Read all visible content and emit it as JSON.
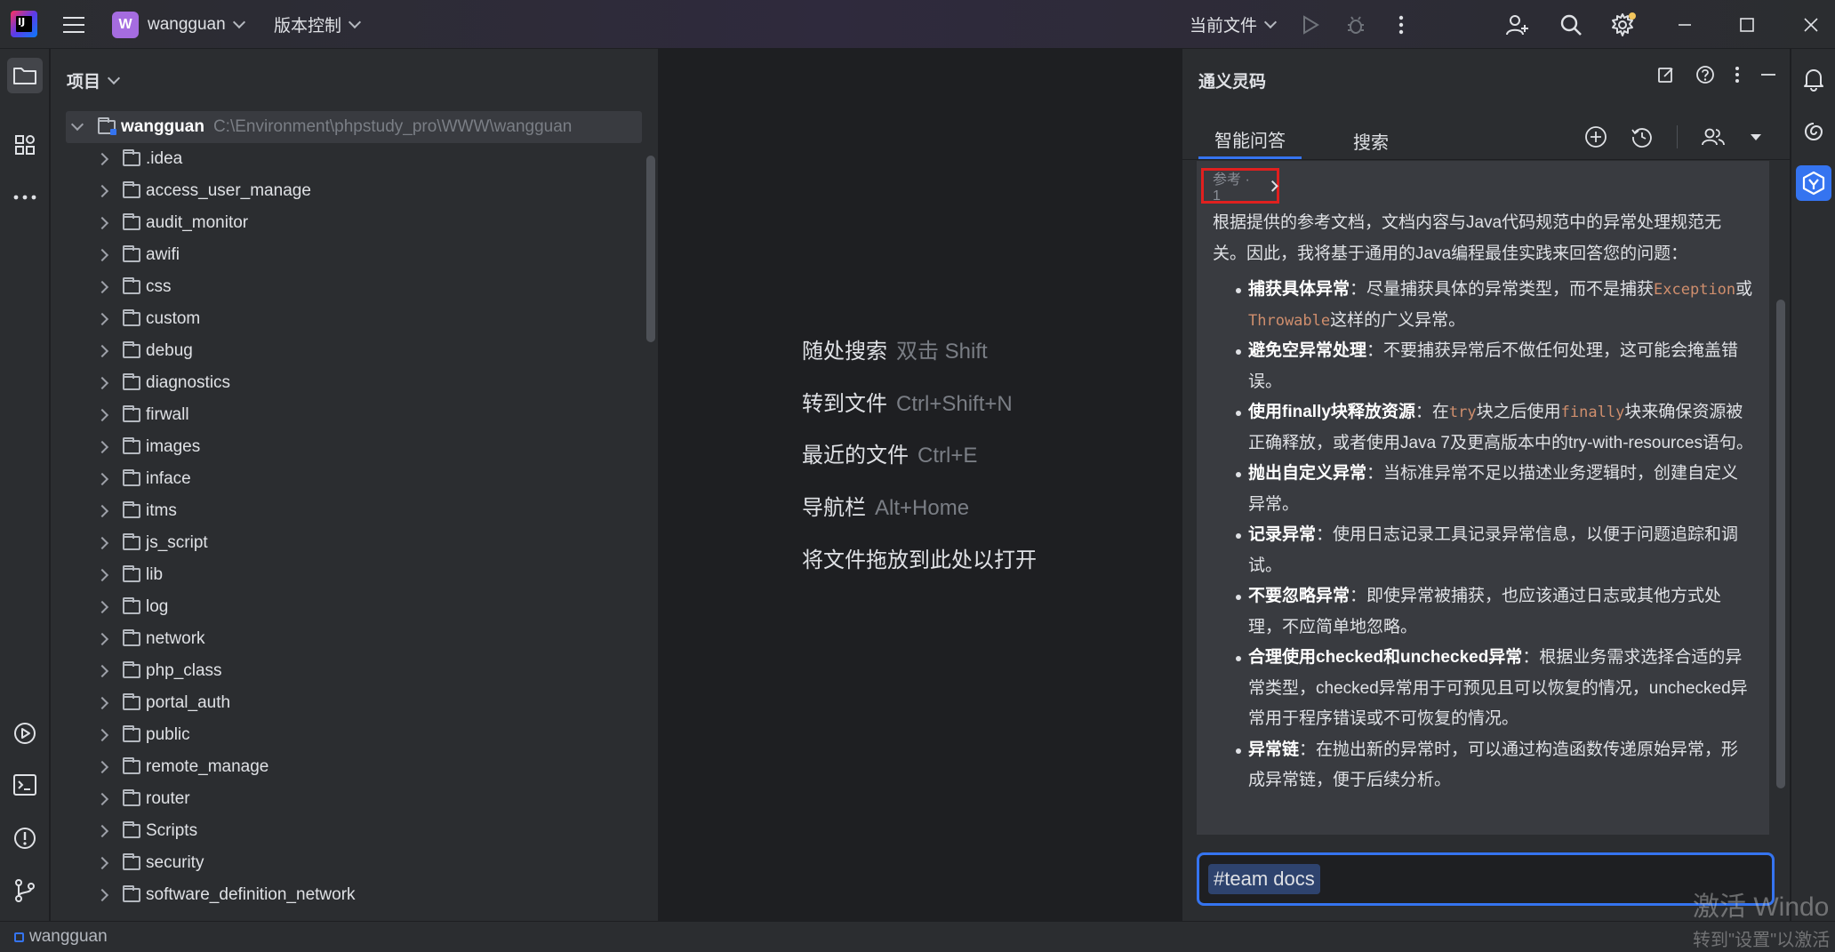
{
  "titlebar": {
    "project_badge": "W",
    "project_name": "wangguan",
    "vcs_menu": "版本控制",
    "run_config": "当前文件"
  },
  "project_panel": {
    "title": "项目",
    "root_name": "wangguan",
    "root_path": "C:\\Environment\\phpstudy_pro\\WWW\\wangguan",
    "folders": [
      ".idea",
      "access_user_manage",
      "audit_monitor",
      "awifi",
      "css",
      "custom",
      "debug",
      "diagnostics",
      "firwall",
      "images",
      "inface",
      "itms",
      "js_script",
      "lib",
      "log",
      "network",
      "php_class",
      "portal_auth",
      "public",
      "remote_manage",
      "router",
      "Scripts",
      "security",
      "software_definition_network"
    ]
  },
  "editor": {
    "hints": [
      {
        "label": "随处搜索",
        "shortcut": "双击 Shift"
      },
      {
        "label": "转到文件",
        "shortcut": "Ctrl+Shift+N"
      },
      {
        "label": "最近的文件",
        "shortcut": "Ctrl+E"
      },
      {
        "label": "导航栏",
        "shortcut": "Alt+Home"
      },
      {
        "label": "将文件拖放到此处以打开",
        "shortcut": ""
      }
    ]
  },
  "ai_panel": {
    "title": "通义灵码",
    "tabs": [
      "智能问答",
      "搜索"
    ],
    "reference": "参考 · 1",
    "intro": "根据提供的参考文档，文档内容与Java代码规范中的异常处理规范无关。因此，我将基于通用的Java编程最佳实践来回答您的问题：",
    "items": [
      {
        "title": "捕获具体异常",
        "text": "：尽量捕获具体的异常类型，而不是捕获",
        "code1": "Exception",
        "mid": "或",
        "code2": "Throwable",
        "tail": "这样的广义异常。"
      },
      {
        "title": "避免空异常处理",
        "text": "：不要捕获异常后不做任何处理，这可能会掩盖错误。"
      },
      {
        "title": "使用finally块释放资源",
        "text": "：在",
        "code1": "try",
        "mid": "块之后使用",
        "code2": "finally",
        "tail": "块来确保资源被正确释放，或者使用Java 7及更高版本中的try-with-resources语句。"
      },
      {
        "title": "抛出自定义异常",
        "text": "：当标准异常不足以描述业务逻辑时，创建自定义异常。"
      },
      {
        "title": "记录异常",
        "text": "：使用日志记录工具记录异常信息，以便于问题追踪和调试。"
      },
      {
        "title": "不要忽略异常",
        "text": "：即使异常被捕获，也应该通过日志或其他方式处理，不应简单地忽略。"
      },
      {
        "title": "合理使用checked和unchecked异常",
        "text": "：根据业务需求选择合适的异常类型，checked异常用于可预见且可以恢复的情况，unchecked异常用于程序错误或不可恢复的情况。"
      },
      {
        "title": "异常链",
        "text": "：在抛出新的异常时，可以通过构造函数传递原始异常，形成异常链，便于后续分析。"
      }
    ],
    "input_tag": "#team docs"
  },
  "statusbar": {
    "project": "wangguan"
  },
  "watermark": {
    "line1": "激活 Windo",
    "line2": "转到\"设置\"以激活"
  },
  "colors": {
    "accent": "#3574f0",
    "highlight_box": "#e0201f",
    "project_badge": "#a56ce0"
  }
}
